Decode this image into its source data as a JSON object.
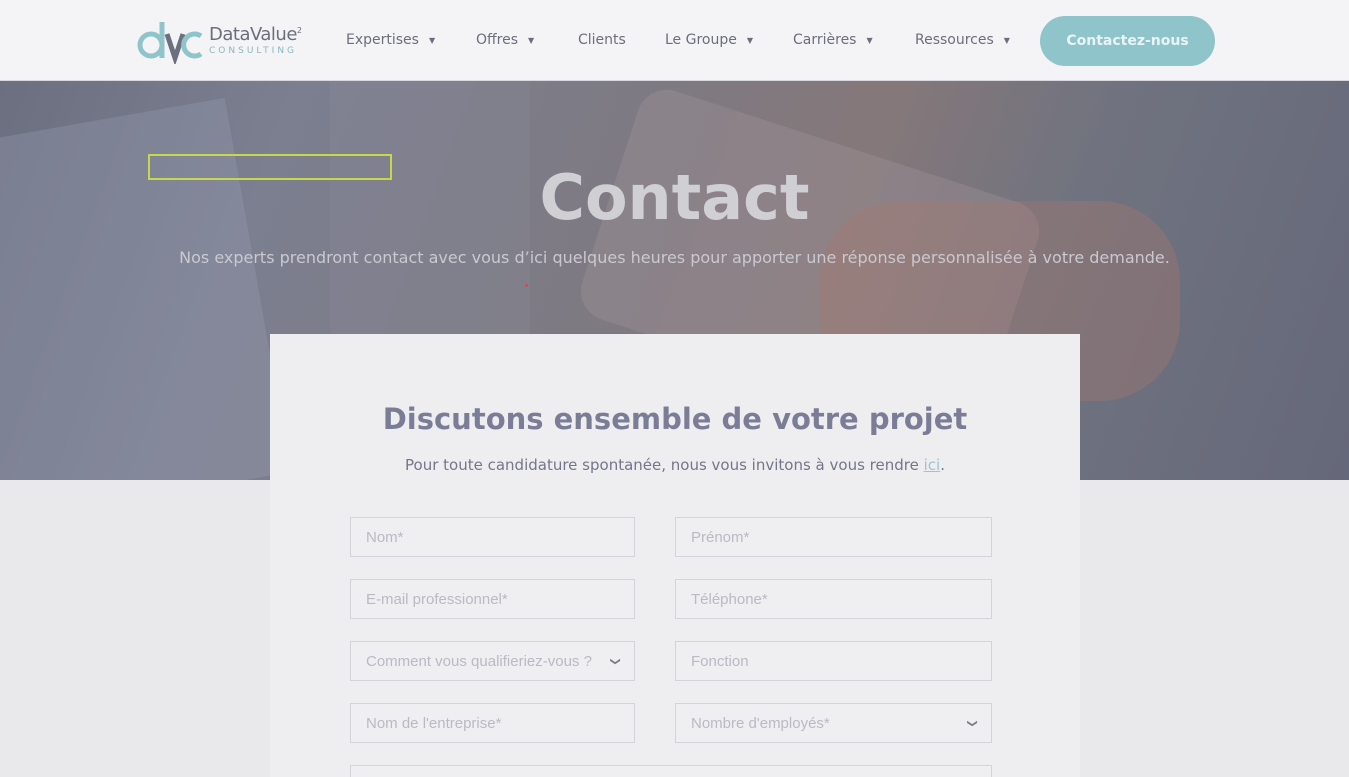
{
  "header": {
    "logo": {
      "name": "DataValue",
      "sup": "2",
      "sub": "CONSULTING"
    },
    "nav": [
      {
        "label": "Expertises",
        "has_caret": true
      },
      {
        "label": "Offres",
        "has_caret": true
      },
      {
        "label": "Clients",
        "has_caret": false
      },
      {
        "label": "Le Groupe",
        "has_caret": true
      },
      {
        "label": "Carrières",
        "has_caret": true
      },
      {
        "label": "Ressources",
        "has_caret": true
      }
    ],
    "cta_label": "Contactez-nous",
    "caret_glyph": "▼"
  },
  "hero": {
    "title": "Contact",
    "subtitle": "Nos experts prendront contact avec vous d’ici quelques heures pour apporter une réponse personnalisée à votre demande."
  },
  "form": {
    "title": "Discutons ensemble de votre projet",
    "subtitle_before": "Pour toute candidature spontanée, nous vous invitons à vous rendre ",
    "subtitle_link": "ici",
    "subtitle_after": ".",
    "fields": {
      "nom": "Nom*",
      "prenom": "Prénom*",
      "email": "E-mail professionnel*",
      "telephone": "Téléphone*",
      "qualification": "Comment vous qualifieriez-vous ?",
      "fonction": "Fonction",
      "entreprise": "Nom de l'entreprise*",
      "employes": "Nombre d'employés*"
    }
  },
  "colors": {
    "accent": "#8fc4cb",
    "title": "#7b7d97",
    "nav_text": "#6b6e7c"
  }
}
